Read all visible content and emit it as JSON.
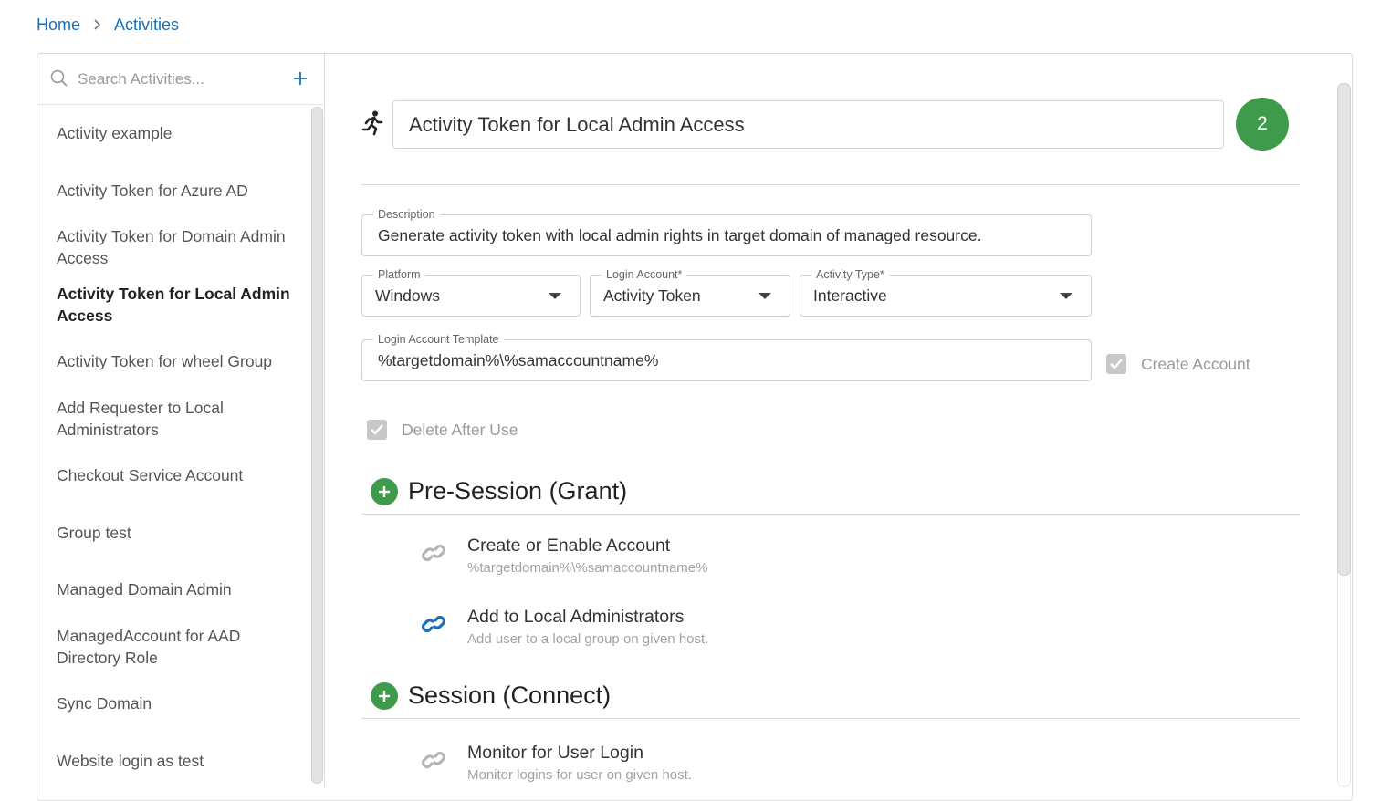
{
  "breadcrumb": {
    "home": "Home",
    "current": "Activities"
  },
  "search": {
    "placeholder": "Search Activities..."
  },
  "sidebar": {
    "items": [
      {
        "label": "Activity example"
      },
      {
        "label": "Activity Token for Azure AD"
      },
      {
        "label": "Activity Token for Domain Admin Access"
      },
      {
        "label": "Activity Token for Local Admin Access",
        "active": true
      },
      {
        "label": "Activity Token for wheel Group"
      },
      {
        "label": "Add Requester to Local Administrators"
      },
      {
        "label": "Checkout Service Account"
      },
      {
        "label": "Group test"
      },
      {
        "label": "Managed Domain Admin"
      },
      {
        "label": "ManagedAccount for AAD Directory Role"
      },
      {
        "label": "Sync Domain"
      },
      {
        "label": "Website login as test"
      }
    ]
  },
  "activity": {
    "title": "Activity Token for Local Admin Access",
    "badge_count": "2",
    "description_label": "Description",
    "description": "Generate activity token with local admin rights in target domain of managed resource.",
    "platform_label": "Platform",
    "platform": "Windows",
    "login_account_label": "Login Account*",
    "login_account": "Activity Token",
    "activity_type_label": "Activity Type*",
    "activity_type": "Interactive",
    "login_template_label": "Login Account Template",
    "login_template": "%targetdomain%\\%samaccountname%",
    "create_account_label": "Create Account",
    "delete_after_use_label": "Delete After Use"
  },
  "sections": {
    "pre_session": {
      "title": "Pre-Session (Grant)",
      "steps": [
        {
          "title": "Create or Enable Account",
          "subtitle": "%targetdomain%\\%samaccountname%",
          "icon_color": "#b5b5b5"
        },
        {
          "title": "Add to Local Administrators",
          "subtitle": "Add user to a local group on given host.",
          "icon_color": "#1a6fb5"
        }
      ]
    },
    "session": {
      "title": "Session (Connect)",
      "steps": [
        {
          "title": "Monitor for User Login",
          "subtitle": "Monitor logins for user on given host.",
          "icon_color": "#b5b5b5"
        }
      ]
    }
  },
  "colors": {
    "accent_green": "#3f9a4b",
    "link_blue": "#1a6fb5"
  }
}
